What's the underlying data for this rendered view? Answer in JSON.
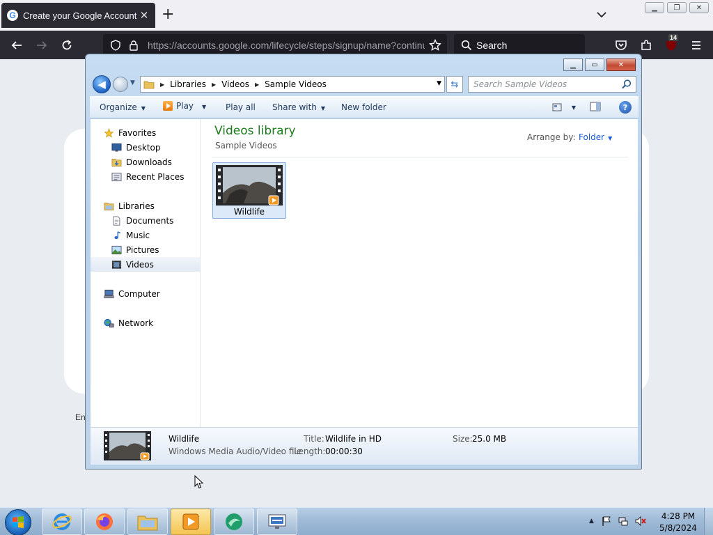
{
  "browser": {
    "tab_title": "Create your Google Account",
    "url": "https://accounts.google.com/lifecycle/steps/signup/name?continu",
    "search_label": "Search",
    "extension_badge": "14"
  },
  "page": {
    "fragment": "En"
  },
  "explorer": {
    "breadcrumb": [
      "Libraries",
      "Videos",
      "Sample Videos"
    ],
    "search_placeholder": "Search Sample Videos",
    "toolbar": {
      "organize": "Organize",
      "play": "Play",
      "play_all": "Play all",
      "share_with": "Share with",
      "new_folder": "New folder"
    },
    "nav": {
      "favorites": "Favorites",
      "desktop": "Desktop",
      "downloads": "Downloads",
      "recent_places": "Recent Places",
      "libraries": "Libraries",
      "documents": "Documents",
      "music": "Music",
      "pictures": "Pictures",
      "videos": "Videos",
      "computer": "Computer",
      "network": "Network"
    },
    "content": {
      "title": "Videos library",
      "subtitle": "Sample Videos",
      "arrange_label": "Arrange by:",
      "arrange_value": "Folder",
      "file_name": "Wildlife"
    },
    "details": {
      "name": "Wildlife",
      "type": "Windows Media Audio/Video file",
      "title_label": "Title:",
      "title_value": "Wildlife in HD",
      "length_label": "Length:",
      "length_value": "00:00:30",
      "size_label": "Size:",
      "size_value": "25.0 MB"
    }
  },
  "taskbar": {
    "time": "4:28 PM",
    "date": "5/8/2024"
  },
  "colors": {
    "library_title": "#1e7b1e",
    "link_blue": "#1a5ad1",
    "taskbar": "#9fbad6"
  }
}
